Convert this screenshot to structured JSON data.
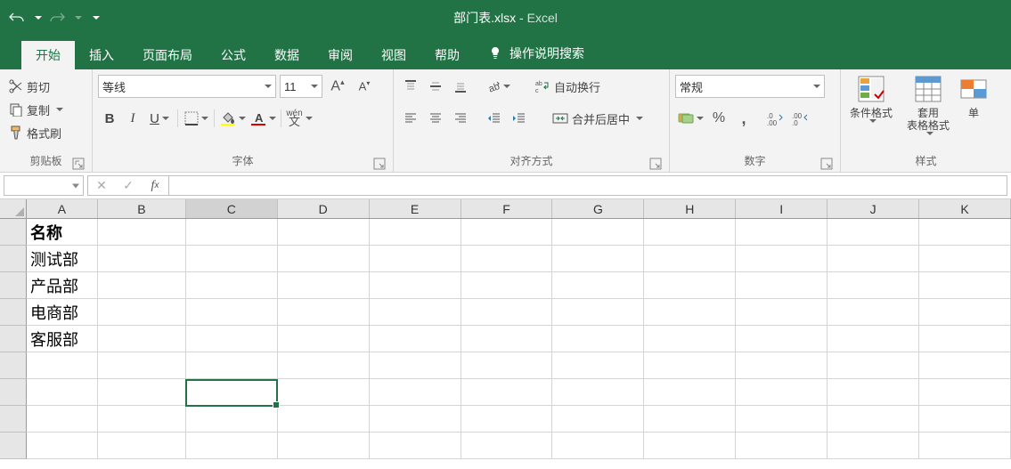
{
  "title": {
    "filename": "部门表.xlsx",
    "separator": " - ",
    "app": "Excel"
  },
  "tabs": [
    "开始",
    "插入",
    "页面布局",
    "公式",
    "数据",
    "审阅",
    "视图",
    "帮助"
  ],
  "active_tab": "开始",
  "tell_me": "操作说明搜索",
  "clipboard": {
    "cut": "剪切",
    "copy": "复制",
    "paint": "格式刷",
    "label": "剪贴板"
  },
  "font": {
    "name": "等线",
    "size": "11",
    "label": "字体"
  },
  "alignment": {
    "wrap": "自动换行",
    "merge": "合并后居中",
    "label": "对齐方式"
  },
  "number": {
    "format": "常规",
    "label": "数字"
  },
  "styles": {
    "cond": "条件格式",
    "table": "套用\n表格格式",
    "cell": "单",
    "label": "样式"
  },
  "name_box": "",
  "columns": [
    "A",
    "B",
    "C",
    "D",
    "E",
    "F",
    "G",
    "H",
    "I",
    "J",
    "K"
  ],
  "selected_col": "C",
  "cells": {
    "r1": {
      "A": "名称"
    },
    "r2": {
      "A": "测试部"
    },
    "r3": {
      "A": "产品部"
    },
    "r4": {
      "A": "电商部"
    },
    "r5": {
      "A": "客服部"
    }
  }
}
